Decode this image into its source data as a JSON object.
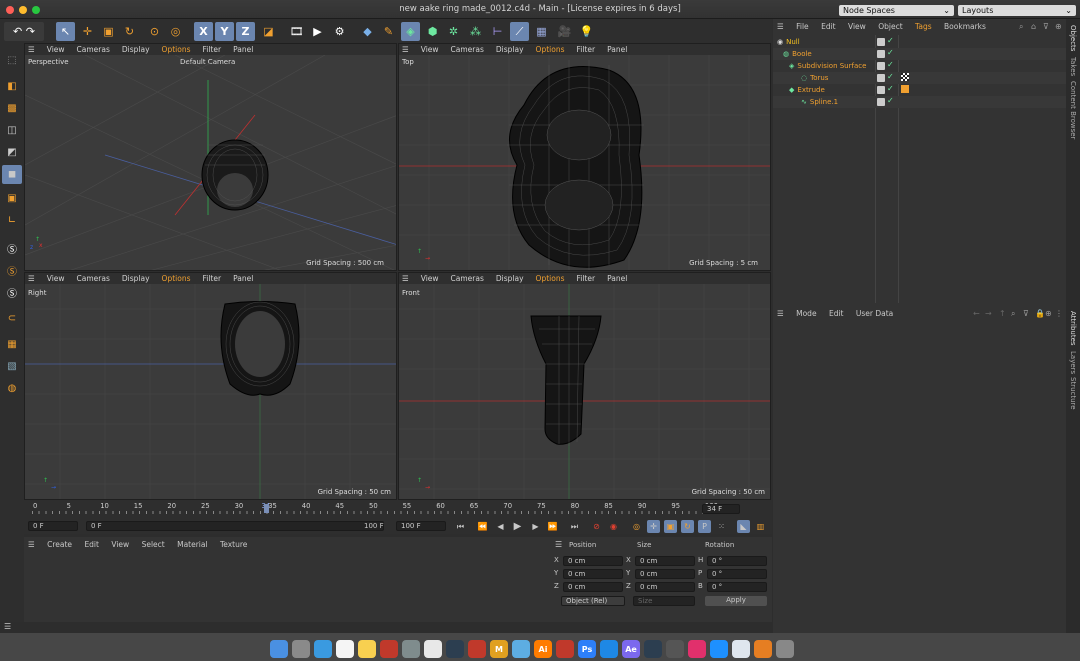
{
  "window": {
    "title": "new aake ring made_0012.c4d - Main - [License expires in 6 days]",
    "node_spaces": "Node Spaces",
    "layouts": "Layouts"
  },
  "toolbar": {
    "icons": [
      "undo-icon",
      "select-icon",
      "move-icon",
      "scale-icon",
      "rotate-icon",
      "live-select-icon",
      "x-axis",
      "y-axis",
      "z-axis",
      "coordinate-system-icon",
      "render-view-icon",
      "render-picture-viewer-icon",
      "render-settings-icon",
      "cube-icon",
      "pen-icon",
      "subdivision-icon",
      "extrude-icon",
      "cloner-icon",
      "deformer-icon",
      "environment-icon",
      "camera-icon",
      "light-icon"
    ],
    "x": "X",
    "y": "Y",
    "z": "Z"
  },
  "viewports": {
    "menu": [
      "View",
      "Cameras",
      "Display",
      "Options",
      "Filter",
      "Panel"
    ],
    "perspective": {
      "label": "Perspective",
      "camera": "Default Camera",
      "grid": "Grid Spacing : 500 cm"
    },
    "top": {
      "label": "Top",
      "grid": "Grid Spacing : 5 cm"
    },
    "right": {
      "label": "Right",
      "grid": "Grid Spacing : 50 cm"
    },
    "front": {
      "label": "Front",
      "grid": "Grid Spacing : 50 cm"
    }
  },
  "timeline": {
    "ticks": [
      "0",
      "5",
      "10",
      "15",
      "20",
      "25",
      "30",
      "34",
      "35",
      "40",
      "45",
      "50",
      "55",
      "60",
      "65",
      "70",
      "75",
      "80",
      "85",
      "90",
      "95",
      "100"
    ],
    "current_frame": "34 F",
    "start": "0 F",
    "start2": "0 F",
    "end": "100 F",
    "end2": "100 F"
  },
  "materials": {
    "menu": [
      "Create",
      "Edit",
      "View",
      "Select",
      "Material",
      "Texture"
    ]
  },
  "coordinates": {
    "headers": [
      "Position",
      "Size",
      "Rotation"
    ],
    "rows": [
      {
        "a": "X",
        "pos": "0 cm",
        "b": "X",
        "size": "0 cm",
        "c": "H",
        "rot": "0 °"
      },
      {
        "a": "Y",
        "pos": "0 cm",
        "b": "Y",
        "size": "0 cm",
        "c": "P",
        "rot": "0 °"
      },
      {
        "a": "Z",
        "pos": "0 cm",
        "b": "Z",
        "size": "0 cm",
        "c": "B",
        "rot": "0 °"
      }
    ],
    "mode": "Object (Rel)",
    "size_mode": "Size",
    "apply": "Apply"
  },
  "objects": {
    "menu": [
      "File",
      "Edit",
      "View",
      "Object",
      "Tags",
      "Bookmarks"
    ],
    "items": [
      {
        "name": "Null",
        "color": "#f4c020"
      },
      {
        "name": "Boole",
        "color": "#f0a030"
      },
      {
        "name": "Subdivision Surface",
        "color": "#f0a030"
      },
      {
        "name": "Torus",
        "color": "#f0a030"
      },
      {
        "name": "Extrude",
        "color": "#f0a030"
      },
      {
        "name": "Spline.1",
        "color": "#f0a030"
      }
    ]
  },
  "attributes": {
    "menu": [
      "Mode",
      "Edit",
      "User Data"
    ]
  },
  "side_tabs": {
    "top": [
      "Objects",
      "Takes",
      "Content Browser"
    ],
    "bottom": [
      "Attributes",
      "Layers",
      "Structure"
    ]
  },
  "dock": {
    "apps": [
      "finder",
      "launchpad",
      "safari",
      "calendar",
      "notes",
      "photo-booth",
      "system-prefs",
      "chrome",
      "quicktime",
      "acrobat",
      "motion",
      "finder2",
      "illustrator",
      "adobe-reader",
      "photoshop",
      "vscode",
      "after-effects",
      "cinema4d",
      "help",
      "instagram",
      "app-store",
      "preview",
      "photos",
      "trash"
    ],
    "labels": [
      "Ai",
      "Ps",
      "Ae",
      "M"
    ]
  },
  "colors": {
    "accent": "#f0a030",
    "select": "#6b86b0",
    "axis_x": "#e03030",
    "axis_y": "#30c050",
    "axis_z": "#3060e0"
  }
}
